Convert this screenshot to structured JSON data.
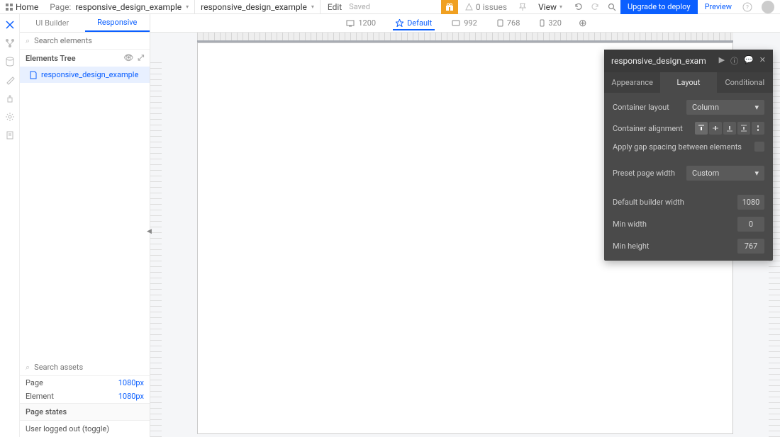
{
  "topbar": {
    "home": "Home",
    "page_prefix": "Page:",
    "page_name": "responsive_design_example",
    "view_name": "responsive_design_example",
    "edit": "Edit",
    "saved": "Saved",
    "issues_count": "0 issues",
    "view_menu": "View",
    "upgrade": "Upgrade to deploy",
    "preview": "Preview"
  },
  "panel": {
    "tab_ui": "UI Builder",
    "tab_responsive": "Responsive",
    "search_elements_placeholder": "Search elements",
    "tree_header": "Elements Tree",
    "tree_item": "responsive_design_example",
    "search_assets_placeholder": "Search assets",
    "page_label": "Page",
    "page_value": "1080px",
    "element_label": "Element",
    "element_value": "1080px",
    "page_states": "Page states",
    "state1": "User logged out (toggle)"
  },
  "breakpoints": {
    "bp1": "1200",
    "bp2": "Default",
    "bp3": "992",
    "bp4": "768",
    "bp5": "320"
  },
  "props": {
    "title": "responsive_design_exam",
    "tab_appearance": "Appearance",
    "tab_layout": "Layout",
    "tab_conditional": "Conditional",
    "container_layout_label": "Container layout",
    "container_layout_value": "Column",
    "container_alignment_label": "Container alignment",
    "gap_label": "Apply gap spacing between elements",
    "preset_width_label": "Preset page width",
    "preset_width_value": "Custom",
    "default_width_label": "Default builder width",
    "default_width_value": "1080",
    "min_width_label": "Min width",
    "min_width_value": "0",
    "min_height_label": "Min height",
    "min_height_value": "767"
  }
}
